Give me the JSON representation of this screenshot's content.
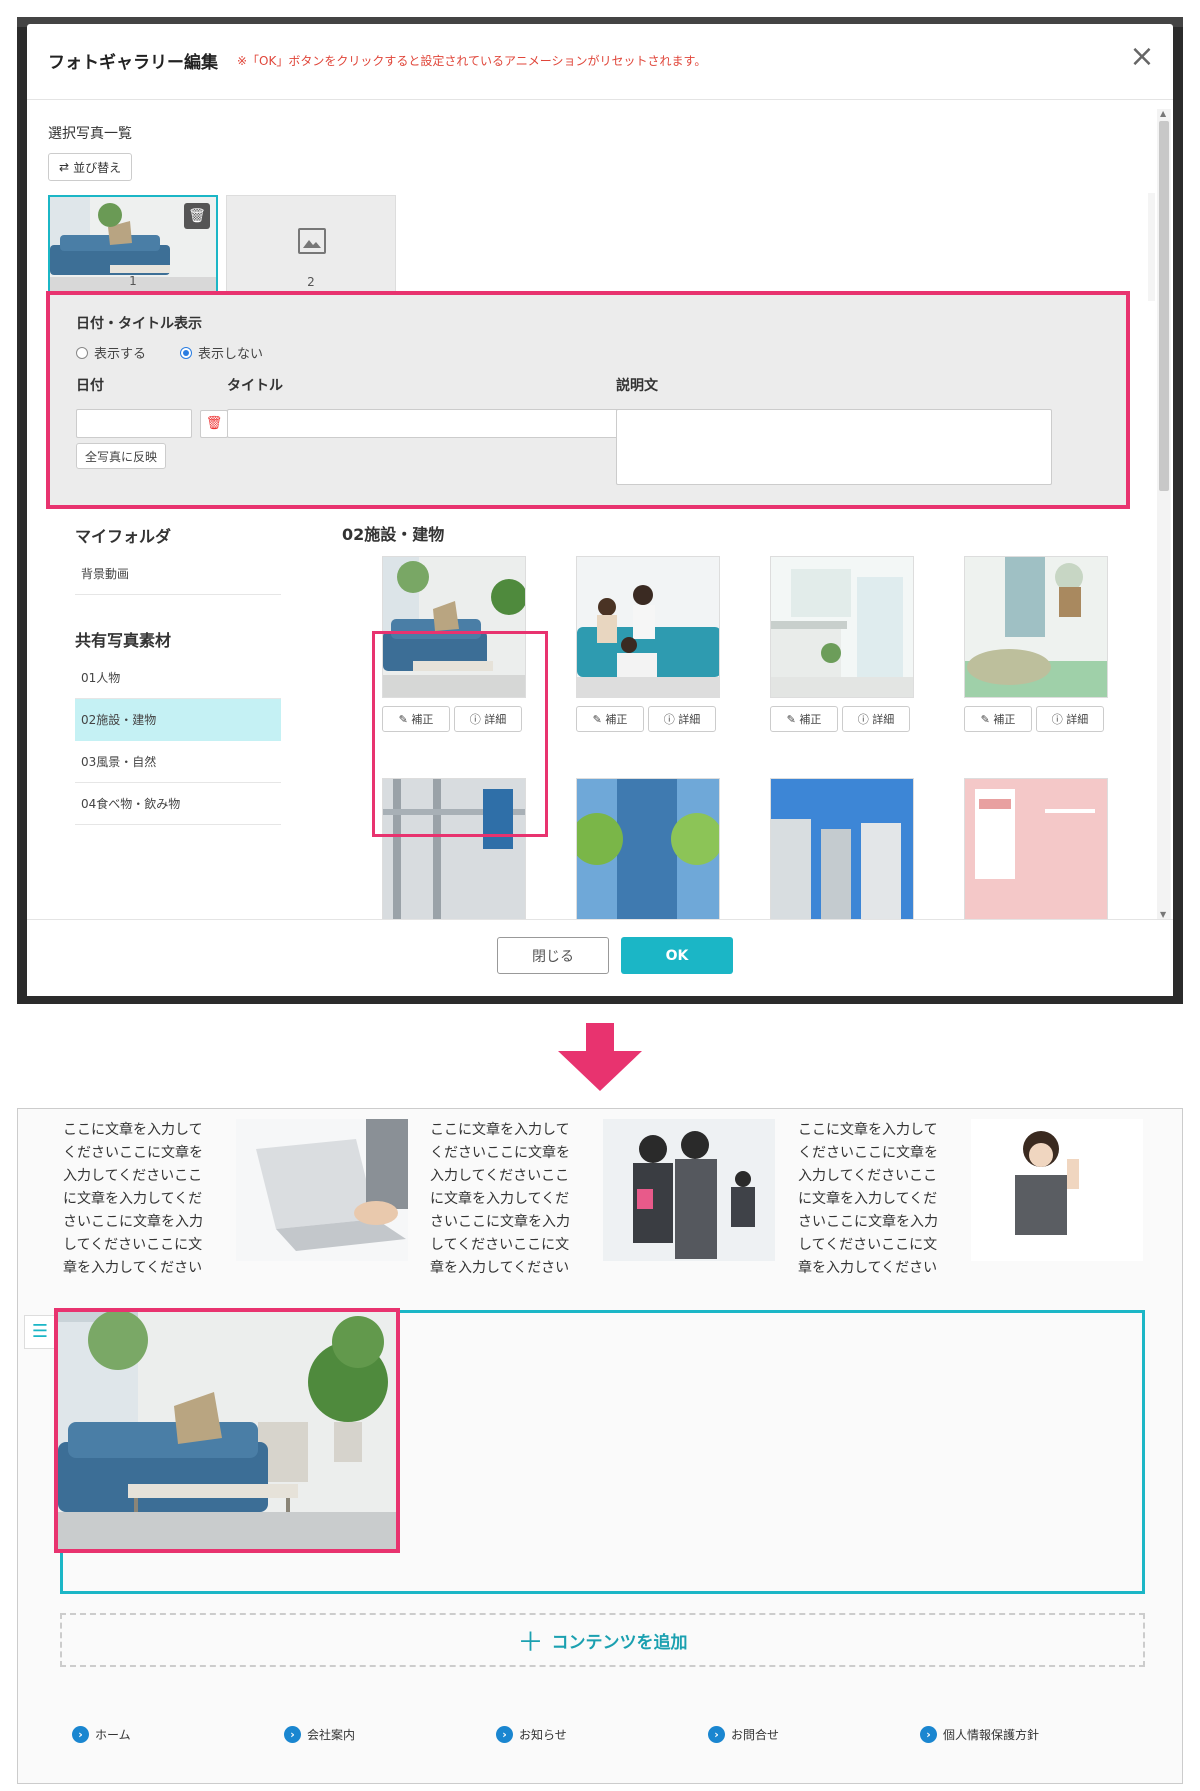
{
  "dialog": {
    "title": "フォトギャラリー編集",
    "note": "※「OK」ボタンをクリックすると設定されているアニメーションがリセットされます。",
    "close_glyph": "×",
    "selected_list_label": "選択写真一覧",
    "sort_label": "並び替え",
    "thumbnails": [
      {
        "num": "1"
      },
      {
        "num": "2"
      }
    ],
    "date_panel": {
      "title": "日付・タイトル表示",
      "radio_show": "表示する",
      "radio_hide": "表示しない",
      "selected": "表示しない",
      "date_label": "日付",
      "title_label": "タイトル",
      "desc_label": "説明文",
      "apply_all": "全写真に反映"
    },
    "folders": {
      "my_folder_heading": "マイフォルダ",
      "my_items": [
        "背景動画"
      ],
      "shared_heading": "共有写真素材",
      "shared_items": [
        "01人物",
        "02施設・建物",
        "03風景・自然",
        "04食べ物・飲み物"
      ],
      "active": "02施設・建物"
    },
    "gallery_title": "02施設・建物",
    "photo_buttons": {
      "adjust": "補正",
      "detail": "詳細"
    },
    "footer": {
      "close": "閉じる",
      "ok": "OK"
    }
  },
  "preview": {
    "paragraph": "ここに文章を入力してくださいここに文章を入力してくださいここに文章を入力してくださいここに文章を入力してくださいここに文章を入力してください",
    "add_content": "コンテンツを追加",
    "nav": [
      "ホーム",
      "会社案内",
      "お知らせ",
      "お問合せ",
      "個人情報保護方針"
    ]
  },
  "colors": {
    "accent": "#1bb6c6",
    "highlight": "#e8336f",
    "warning": "#e0463a"
  }
}
